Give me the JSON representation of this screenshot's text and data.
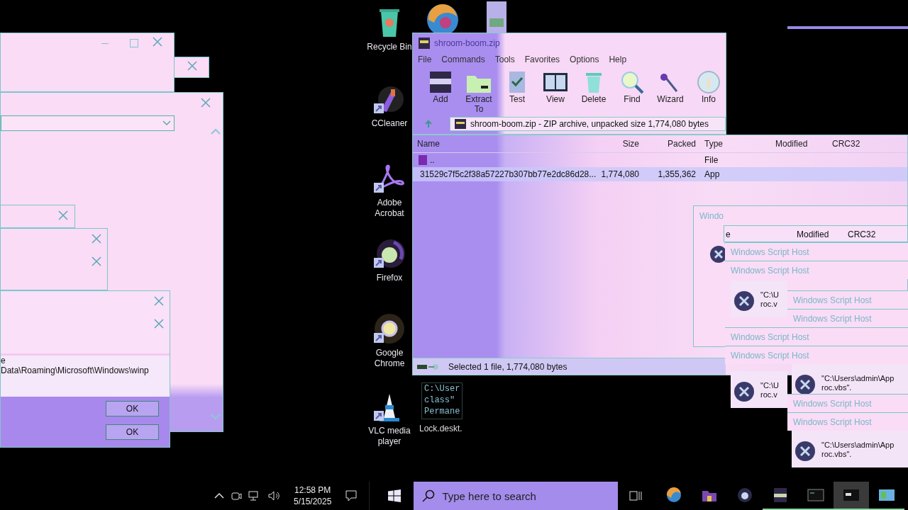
{
  "desktop_icons": [
    {
      "label": "Recycle Bin",
      "kind": "bin",
      "shortcut": false
    },
    {
      "label": "CCleaner",
      "kind": "ccleaner",
      "shortcut": true
    },
    {
      "label": "Adobe Acrobat",
      "kind": "acrobat",
      "shortcut": true
    },
    {
      "label": "Firefox",
      "kind": "firefox",
      "shortcut": true
    },
    {
      "label": "Google Chrome",
      "kind": "chrome",
      "shortcut": true
    },
    {
      "label": "VLC media player",
      "kind": "vlc",
      "shortcut": true
    }
  ],
  "console": {
    "lines": [
      "C:\\User",
      "class\"",
      "Permane"
    ],
    "file_label": "Lock.deskt."
  },
  "archive": {
    "title": "shroom-boom.zip",
    "menu": [
      "File",
      "Commands",
      "Tools",
      "Favorites",
      "Options",
      "Help"
    ],
    "toolbar": [
      {
        "label": "Add",
        "kind": "add"
      },
      {
        "label": "Extract To",
        "kind": "extract"
      },
      {
        "label": "Test",
        "kind": "test"
      },
      {
        "label": "View",
        "kind": "view"
      },
      {
        "label": "Delete",
        "kind": "delete"
      },
      {
        "label": "Find",
        "kind": "find"
      },
      {
        "label": "Wizard",
        "kind": "wizard"
      },
      {
        "label": "Info",
        "kind": "info"
      }
    ],
    "path": "shroom-boom.zip - ZIP archive, unpacked size 1,774,080 bytes",
    "columns": [
      "Name",
      "Size",
      "Packed",
      "Type",
      "Modified",
      "CRC32"
    ],
    "rows": [
      {
        "kind": "folder",
        "name": "..",
        "type": "File",
        "selected": false
      },
      {
        "kind": "app",
        "name": "31529c7f5c2f38a57227b307bb77e2dc86d28...",
        "size": "1,774,080",
        "packed": "1,355,362",
        "type": "App",
        "selected": true
      }
    ],
    "status": "Selected 1 file, 1,774,080 bytes"
  },
  "left_dialog": {
    "lines": [
      "e",
      "Data\\Roaming\\Microsoft\\Windows\\winp"
    ],
    "buttons": [
      "OK",
      "OK"
    ]
  },
  "script_host": {
    "window_title": "Windo",
    "columns": [
      "e",
      "Modified",
      "CRC32"
    ],
    "titles": [
      "Windows Script Host",
      "Windows Script Host",
      "Windows Script Host",
      "Windows Script Host",
      "Windows Script Host",
      "Windows Script Host",
      "Windows Script Host",
      "Windows Script Host"
    ],
    "messages": [
      {
        "lines": [
          "\"C:\\U",
          "roc.v"
        ]
      },
      {
        "lines": [
          "\"C:\\Users\\admin\\App",
          "roc.vbs\"."
        ]
      },
      {
        "lines": [
          "\"C:\\U",
          "roc.v"
        ]
      },
      {
        "lines": [
          "\"C:\\Users\\admin\\App",
          "roc.vbs\"."
        ]
      }
    ]
  },
  "taskbar": {
    "search_placeholder": "Type here to search",
    "time": "12:58 PM",
    "date": "5/15/2025",
    "apps": [
      {
        "kind": "edge",
        "running": false,
        "selected": false
      },
      {
        "kind": "explorer",
        "running": false,
        "selected": false
      },
      {
        "kind": "firefox",
        "running": false,
        "selected": false
      },
      {
        "kind": "winrar",
        "running": true,
        "selected": false
      },
      {
        "kind": "terminal",
        "running": true,
        "selected": false
      },
      {
        "kind": "console",
        "running": true,
        "selected": true
      },
      {
        "kind": "app",
        "running": true,
        "selected": false
      }
    ]
  }
}
